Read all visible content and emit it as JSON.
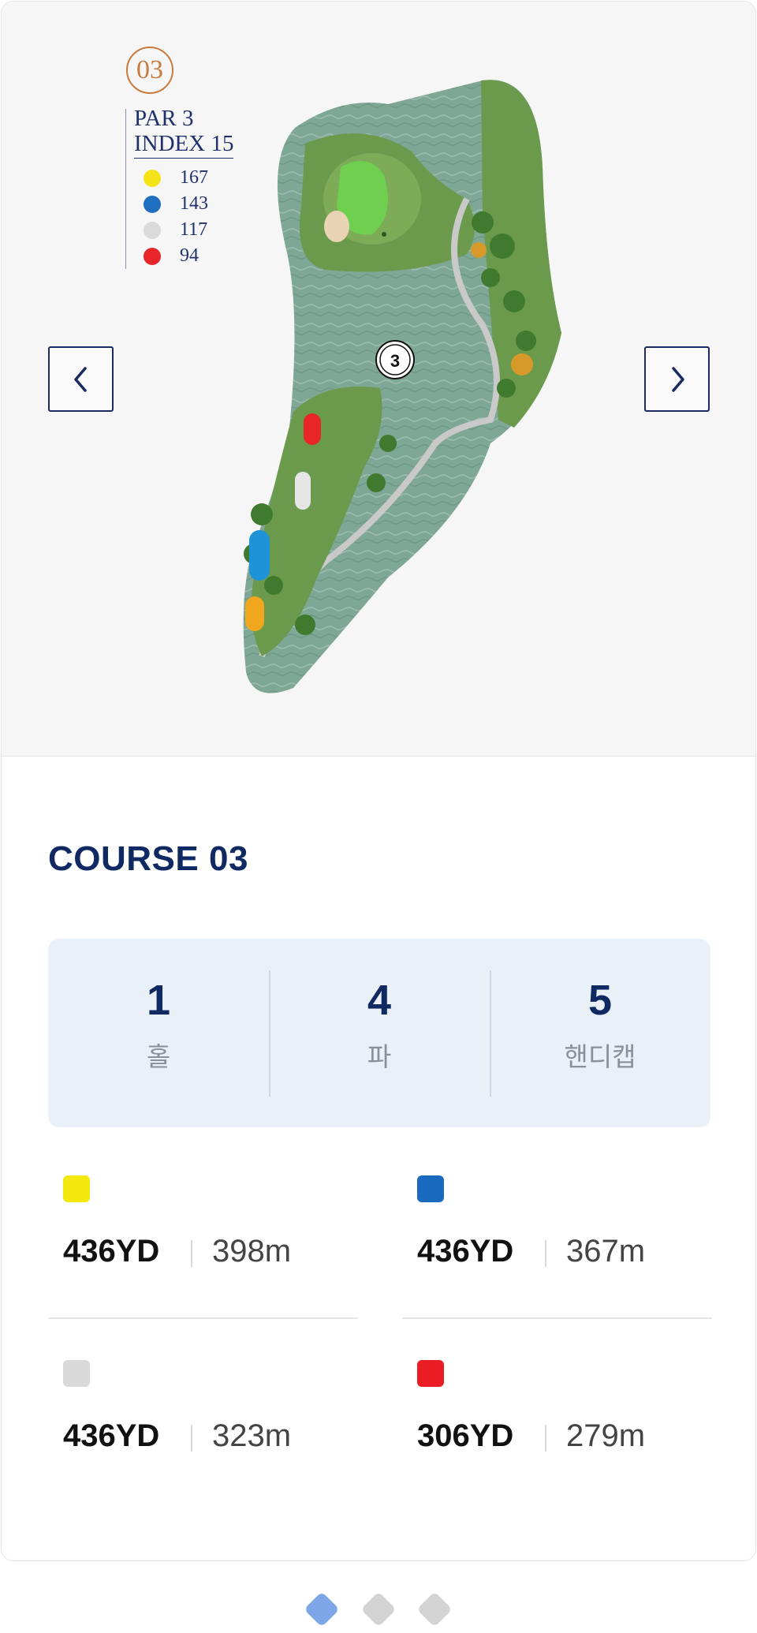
{
  "hole": {
    "number": "03",
    "par": "PAR 3",
    "index": "INDEX 15",
    "badge_color": "#c97a3d",
    "tees": [
      {
        "color": "#f5e319",
        "distance": "167"
      },
      {
        "color": "#1f6fc0",
        "distance": "143"
      },
      {
        "color": "#dadada",
        "distance": "117"
      },
      {
        "color": "#e8262a",
        "distance": "94"
      }
    ],
    "map_marker": "3"
  },
  "nav": {
    "prev_icon": "chevron-left-icon",
    "next_icon": "chevron-right-icon"
  },
  "course": {
    "title": "COURSE 03",
    "stats": [
      {
        "value": "1",
        "label": "홀"
      },
      {
        "value": "4",
        "label": "파"
      },
      {
        "value": "5",
        "label": "핸디캡"
      }
    ],
    "tee_distances": [
      {
        "color": "#f5e80f",
        "yards": "436YD",
        "meters": "398m"
      },
      {
        "color": "#1a6bbf",
        "yards": "436YD",
        "meters": "367m"
      },
      {
        "color": "#d9d9d9",
        "yards": "436YD",
        "meters": "323m"
      },
      {
        "color": "#ea1c24",
        "yards": "306YD",
        "meters": "279m"
      }
    ]
  },
  "pagination": {
    "count": 3,
    "active": 0,
    "active_color": "#7ca6e8",
    "inactive_color": "#d4d4d4"
  }
}
